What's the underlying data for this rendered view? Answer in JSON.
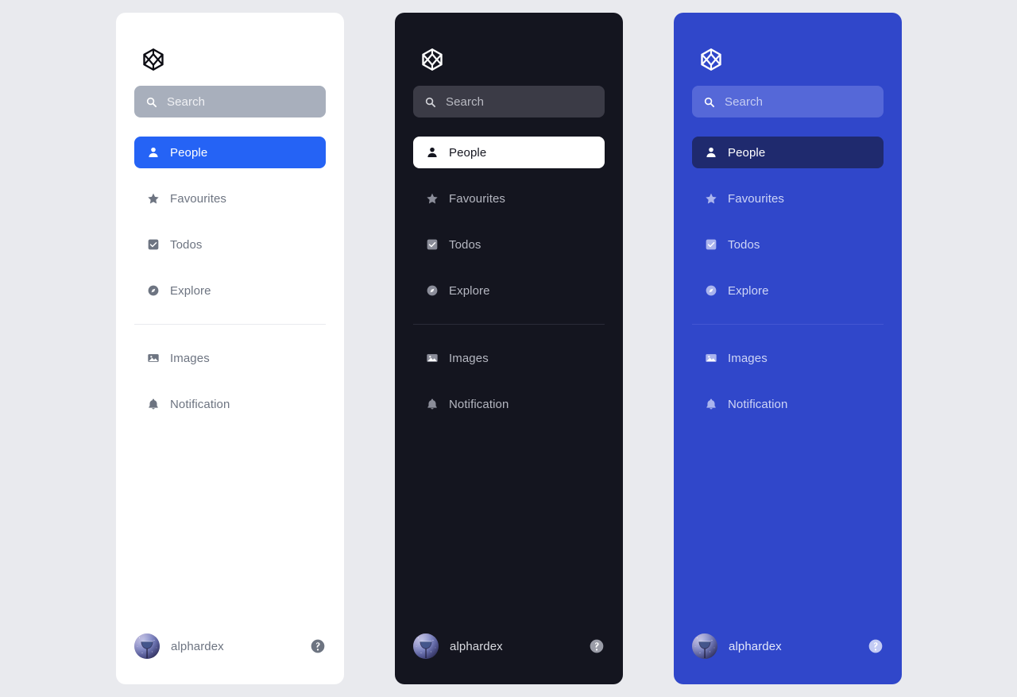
{
  "app": {
    "logo_icon": "cube-hexagon-logo-icon",
    "background_color": "#e9eaee"
  },
  "panels": [
    {
      "id": "light",
      "theme_name": "Light",
      "background_color": "#ffffff",
      "accent_color": "#2563f5",
      "search": {
        "placeholder": "Search",
        "value": "",
        "icon": "search-icon"
      },
      "primary_nav": [
        {
          "label": "People",
          "icon": "person-icon",
          "active": true
        },
        {
          "label": "Favourites",
          "icon": "star-icon",
          "active": false
        },
        {
          "label": "Todos",
          "icon": "checkbox-icon",
          "active": false
        },
        {
          "label": "Explore",
          "icon": "compass-icon",
          "active": false
        }
      ],
      "secondary_nav": [
        {
          "label": "Images",
          "icon": "image-icon",
          "active": false
        },
        {
          "label": "Notification",
          "icon": "bell-icon",
          "active": false
        }
      ],
      "footer": {
        "user_name": "alphardex",
        "avatar": "user-avatar",
        "help": "help-circle-icon"
      }
    },
    {
      "id": "dark",
      "theme_name": "Dark",
      "background_color": "#14151f",
      "accent_color": "#ffffff",
      "search": {
        "placeholder": "Search",
        "value": "",
        "icon": "search-icon"
      },
      "primary_nav": [
        {
          "label": "People",
          "icon": "person-icon",
          "active": true
        },
        {
          "label": "Favourites",
          "icon": "star-icon",
          "active": false
        },
        {
          "label": "Todos",
          "icon": "checkbox-icon",
          "active": false
        },
        {
          "label": "Explore",
          "icon": "compass-icon",
          "active": false
        }
      ],
      "secondary_nav": [
        {
          "label": "Images",
          "icon": "image-icon",
          "active": false
        },
        {
          "label": "Notification",
          "icon": "bell-icon",
          "active": false
        }
      ],
      "footer": {
        "user_name": "alphardex",
        "avatar": "user-avatar",
        "help": "help-circle-icon"
      }
    },
    {
      "id": "blue",
      "theme_name": "Blue",
      "background_color": "#3047ca",
      "accent_color": "#1f2a6e",
      "search": {
        "placeholder": "Search",
        "value": "",
        "icon": "search-icon"
      },
      "primary_nav": [
        {
          "label": "People",
          "icon": "person-icon",
          "active": true
        },
        {
          "label": "Favourites",
          "icon": "star-icon",
          "active": false
        },
        {
          "label": "Todos",
          "icon": "checkbox-icon",
          "active": false
        },
        {
          "label": "Explore",
          "icon": "compass-icon",
          "active": false
        }
      ],
      "secondary_nav": [
        {
          "label": "Images",
          "icon": "image-icon",
          "active": false
        },
        {
          "label": "Notification",
          "icon": "bell-icon",
          "active": false
        }
      ],
      "footer": {
        "user_name": "alphardex",
        "avatar": "user-avatar",
        "help": "help-circle-icon"
      }
    }
  ]
}
